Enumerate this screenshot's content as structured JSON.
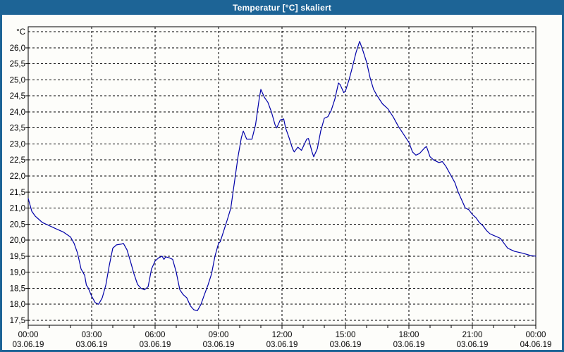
{
  "window": {
    "title": "Temperatur [°C] skaliert"
  },
  "colors": {
    "titlebar_bg": "#1d6496",
    "titlebar_text": "#ffffff",
    "window_border": "#1d6496",
    "plot_bg": "#fdfdfa",
    "grid_line": "#000000",
    "axis_line": "#000000",
    "series_line": "#0000a8",
    "label_text": "#000000"
  },
  "chart_data": {
    "type": "line",
    "title": "Temperatur [°C] skaliert",
    "xlabel": "",
    "ylabel": "°C",
    "ylim": [
      17.5,
      26.5
    ],
    "xlim_hours": [
      0,
      24
    ],
    "grid": "dashed",
    "legend": "none",
    "y_axis": {
      "unit": "°C",
      "tick_step": 0.5,
      "ticks": [
        {
          "value": 26.0,
          "label": "26,0"
        },
        {
          "value": 25.5,
          "label": "25,5"
        },
        {
          "value": 25.0,
          "label": "25,0"
        },
        {
          "value": 24.5,
          "label": "24,5"
        },
        {
          "value": 24.0,
          "label": "24,0"
        },
        {
          "value": 23.5,
          "label": "23,5"
        },
        {
          "value": 23.0,
          "label": "23,0"
        },
        {
          "value": 22.5,
          "label": "22,5"
        },
        {
          "value": 22.0,
          "label": "22,0"
        },
        {
          "value": 21.5,
          "label": "21,5"
        },
        {
          "value": 21.0,
          "label": "21,0"
        },
        {
          "value": 20.5,
          "label": "20,5"
        },
        {
          "value": 20.0,
          "label": "20,0"
        },
        {
          "value": 19.5,
          "label": "19,5"
        },
        {
          "value": 19.0,
          "label": "19,0"
        },
        {
          "value": 18.5,
          "label": "18,5"
        },
        {
          "value": 18.0,
          "label": "18,0"
        },
        {
          "value": 17.5,
          "label": "17,5"
        }
      ]
    },
    "x_axis": {
      "major_tick_hours": 3,
      "minor_tick_hours": 1,
      "ticks": [
        {
          "hour": 0,
          "time": "00:00",
          "date": "03.06.19"
        },
        {
          "hour": 3,
          "time": "03:00",
          "date": "03.06.19"
        },
        {
          "hour": 6,
          "time": "06:00",
          "date": "03.06.19"
        },
        {
          "hour": 9,
          "time": "09:00",
          "date": "03.06.19"
        },
        {
          "hour": 12,
          "time": "12:00",
          "date": "03.06.19"
        },
        {
          "hour": 15,
          "time": "15:00",
          "date": "03.06.19"
        },
        {
          "hour": 18,
          "time": "18:00",
          "date": "03.06.19"
        },
        {
          "hour": 21,
          "time": "21:00",
          "date": "03.06.19"
        },
        {
          "hour": 24,
          "time": "00:00",
          "date": "04.06.19"
        }
      ]
    },
    "series": [
      {
        "name": "Temperatur",
        "color": "#0000a8",
        "points": [
          [
            0.0,
            21.3
          ],
          [
            0.17,
            20.9
          ],
          [
            0.33,
            20.75
          ],
          [
            0.5,
            20.65
          ],
          [
            0.67,
            20.55
          ],
          [
            1.0,
            20.45
          ],
          [
            1.33,
            20.35
          ],
          [
            1.67,
            20.25
          ],
          [
            2.0,
            20.1
          ],
          [
            2.17,
            19.9
          ],
          [
            2.33,
            19.6
          ],
          [
            2.5,
            19.1
          ],
          [
            2.67,
            18.9
          ],
          [
            2.75,
            18.6
          ],
          [
            2.83,
            18.52
          ],
          [
            3.0,
            18.25
          ],
          [
            3.17,
            18.05
          ],
          [
            3.33,
            18.0
          ],
          [
            3.5,
            18.2
          ],
          [
            3.67,
            18.6
          ],
          [
            3.83,
            19.2
          ],
          [
            4.0,
            19.75
          ],
          [
            4.17,
            19.85
          ],
          [
            4.42,
            19.88
          ],
          [
            4.5,
            19.9
          ],
          [
            4.67,
            19.7
          ],
          [
            4.83,
            19.35
          ],
          [
            5.0,
            18.95
          ],
          [
            5.17,
            18.62
          ],
          [
            5.33,
            18.5
          ],
          [
            5.5,
            18.45
          ],
          [
            5.67,
            18.55
          ],
          [
            5.83,
            19.1
          ],
          [
            6.0,
            19.35
          ],
          [
            6.17,
            19.45
          ],
          [
            6.33,
            19.5
          ],
          [
            6.42,
            19.4
          ],
          [
            6.5,
            19.48
          ],
          [
            6.67,
            19.45
          ],
          [
            6.83,
            19.4
          ],
          [
            7.0,
            19.0
          ],
          [
            7.17,
            18.45
          ],
          [
            7.33,
            18.3
          ],
          [
            7.5,
            18.2
          ],
          [
            7.67,
            17.95
          ],
          [
            7.83,
            17.83
          ],
          [
            8.0,
            17.8
          ],
          [
            8.17,
            18.0
          ],
          [
            8.33,
            18.3
          ],
          [
            8.5,
            18.6
          ],
          [
            8.67,
            18.95
          ],
          [
            8.83,
            19.5
          ],
          [
            9.0,
            19.9
          ],
          [
            9.08,
            19.95
          ],
          [
            9.25,
            20.3
          ],
          [
            9.42,
            20.65
          ],
          [
            9.58,
            21.0
          ],
          [
            9.75,
            21.8
          ],
          [
            9.92,
            22.6
          ],
          [
            10.08,
            23.2
          ],
          [
            10.17,
            23.4
          ],
          [
            10.33,
            23.15
          ],
          [
            10.58,
            23.15
          ],
          [
            10.75,
            23.6
          ],
          [
            10.92,
            24.4
          ],
          [
            11.0,
            24.7
          ],
          [
            11.17,
            24.45
          ],
          [
            11.33,
            24.3
          ],
          [
            11.5,
            24.0
          ],
          [
            11.67,
            23.6
          ],
          [
            11.75,
            23.5
          ],
          [
            11.92,
            23.75
          ],
          [
            12.08,
            23.78
          ],
          [
            12.17,
            23.5
          ],
          [
            12.33,
            23.2
          ],
          [
            12.5,
            22.85
          ],
          [
            12.58,
            22.75
          ],
          [
            12.75,
            22.9
          ],
          [
            12.92,
            22.8
          ],
          [
            13.17,
            23.15
          ],
          [
            13.25,
            23.17
          ],
          [
            13.42,
            22.75
          ],
          [
            13.5,
            22.6
          ],
          [
            13.67,
            22.85
          ],
          [
            13.83,
            23.4
          ],
          [
            14.0,
            23.8
          ],
          [
            14.17,
            23.85
          ],
          [
            14.33,
            24.05
          ],
          [
            14.5,
            24.4
          ],
          [
            14.67,
            24.9
          ],
          [
            14.75,
            24.85
          ],
          [
            14.92,
            24.6
          ],
          [
            15.0,
            24.65
          ],
          [
            15.17,
            25.0
          ],
          [
            15.33,
            25.4
          ],
          [
            15.5,
            25.85
          ],
          [
            15.67,
            26.2
          ],
          [
            15.83,
            25.9
          ],
          [
            16.0,
            25.55
          ],
          [
            16.17,
            25.05
          ],
          [
            16.33,
            24.7
          ],
          [
            16.5,
            24.5
          ],
          [
            16.75,
            24.25
          ],
          [
            17.0,
            24.1
          ],
          [
            17.25,
            23.85
          ],
          [
            17.5,
            23.55
          ],
          [
            17.75,
            23.3
          ],
          [
            18.0,
            23.05
          ],
          [
            18.17,
            22.75
          ],
          [
            18.33,
            22.65
          ],
          [
            18.5,
            22.7
          ],
          [
            18.75,
            22.88
          ],
          [
            18.83,
            22.92
          ],
          [
            19.0,
            22.6
          ],
          [
            19.17,
            22.5
          ],
          [
            19.42,
            22.42
          ],
          [
            19.58,
            22.45
          ],
          [
            19.75,
            22.3
          ],
          [
            20.0,
            22.0
          ],
          [
            20.17,
            21.8
          ],
          [
            20.33,
            21.5
          ],
          [
            20.5,
            21.25
          ],
          [
            20.67,
            21.0
          ],
          [
            20.83,
            20.95
          ],
          [
            21.0,
            20.8
          ],
          [
            21.17,
            20.7
          ],
          [
            21.33,
            20.55
          ],
          [
            21.5,
            20.45
          ],
          [
            21.67,
            20.3
          ],
          [
            21.83,
            20.2
          ],
          [
            22.0,
            20.15
          ],
          [
            22.25,
            20.08
          ],
          [
            22.33,
            20.05
          ],
          [
            22.5,
            19.9
          ],
          [
            22.67,
            19.75
          ],
          [
            22.83,
            19.7
          ],
          [
            23.0,
            19.65
          ],
          [
            23.33,
            19.6
          ],
          [
            23.5,
            19.57
          ],
          [
            23.75,
            19.52
          ],
          [
            24.0,
            19.5
          ]
        ]
      }
    ]
  }
}
